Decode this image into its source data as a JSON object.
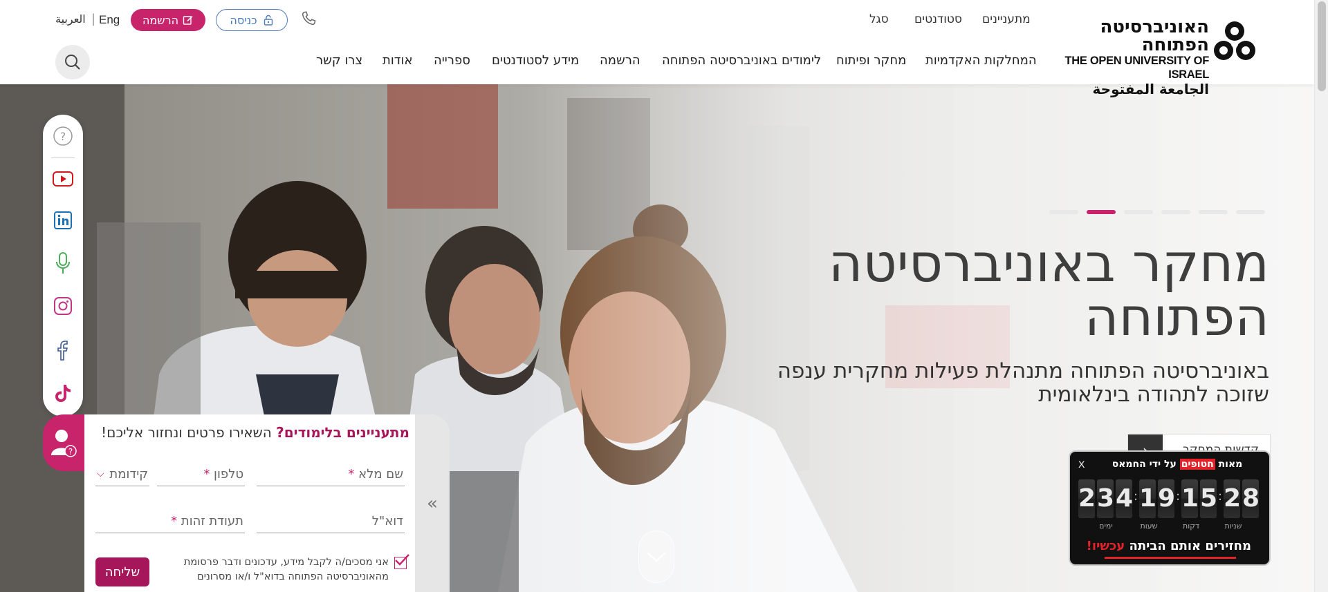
{
  "header": {
    "logo": {
      "hebrew": "האוניברסיטה הפתוחה",
      "english": "THE OPEN UNIVERSITY OF ISRAEL",
      "arabic": "الجامعة المفتوحة"
    },
    "top_links": [
      "מתעניינים",
      "סטודנטים",
      "סגל"
    ],
    "login_label": "כניסה",
    "register_label": "הרשמה",
    "lang_eng": "Eng",
    "lang_separator": "|",
    "lang_ar": "العربية",
    "main_nav": [
      "המחלקות האקדמיות",
      "מחקר ופיתוח",
      "לימודים באוניברסיטה הפתוחה",
      "הרשמה",
      "מידע לסטודנטים",
      "ספרייה",
      "אודות",
      "צרו קשר"
    ]
  },
  "hero": {
    "title": "מחקר באוניברסיטה הפתוחה",
    "subtitle": "באוניברסיטה הפתוחה מתנהלת פעילות מחקרית ענפה שזוכה לתהודה בינלאומית",
    "cta_label": "קדשות המחקר",
    "slide_count": 6,
    "active_slide": 4
  },
  "social": [
    "help-icon",
    "youtube-icon",
    "linkedin-icon",
    "microphone-icon",
    "instagram-icon",
    "facebook-icon",
    "tiktok-icon"
  ],
  "lead_form": {
    "title_highlight": "מתעניינים בלימודים?",
    "title_rest": " השאירו פרטים ונחזור אליכם!",
    "name_label": "שם מלא",
    "phone_label": "טלפון",
    "prefix_label": "קידומת",
    "email_label": "דוא\"ל",
    "id_label": "תעודת זהות",
    "required_mark": "*",
    "consent_text": "אני מסכים/ה לקבל מידע, עדכונים ודבר פרסומת מהאוניברסיטה הפתוחה בדוא\"ל ו/או מסרונים",
    "send_label": "שליחה",
    "collapse_glyph": "«"
  },
  "countdown": {
    "close_label": "X",
    "head_before": "מאות ",
    "head_highlight": "חטופים",
    "head_after": " על ידי החמאס",
    "days": "234",
    "hours": "19",
    "minutes": "15",
    "seconds": "28",
    "unit_days": "ימים",
    "unit_hours": "שעות",
    "unit_minutes": "דקות",
    "unit_seconds": "שניות",
    "foot_text": "מחזירים אותם הביתה ",
    "foot_now": "עכשיו!",
    "colors": {
      "background": "#111111",
      "highlight": "#e3222a"
    }
  },
  "colors": {
    "brand_pink": "#c7246b",
    "brand_dark_pink": "#a5175a",
    "login_blue": "#4b7ab8"
  }
}
